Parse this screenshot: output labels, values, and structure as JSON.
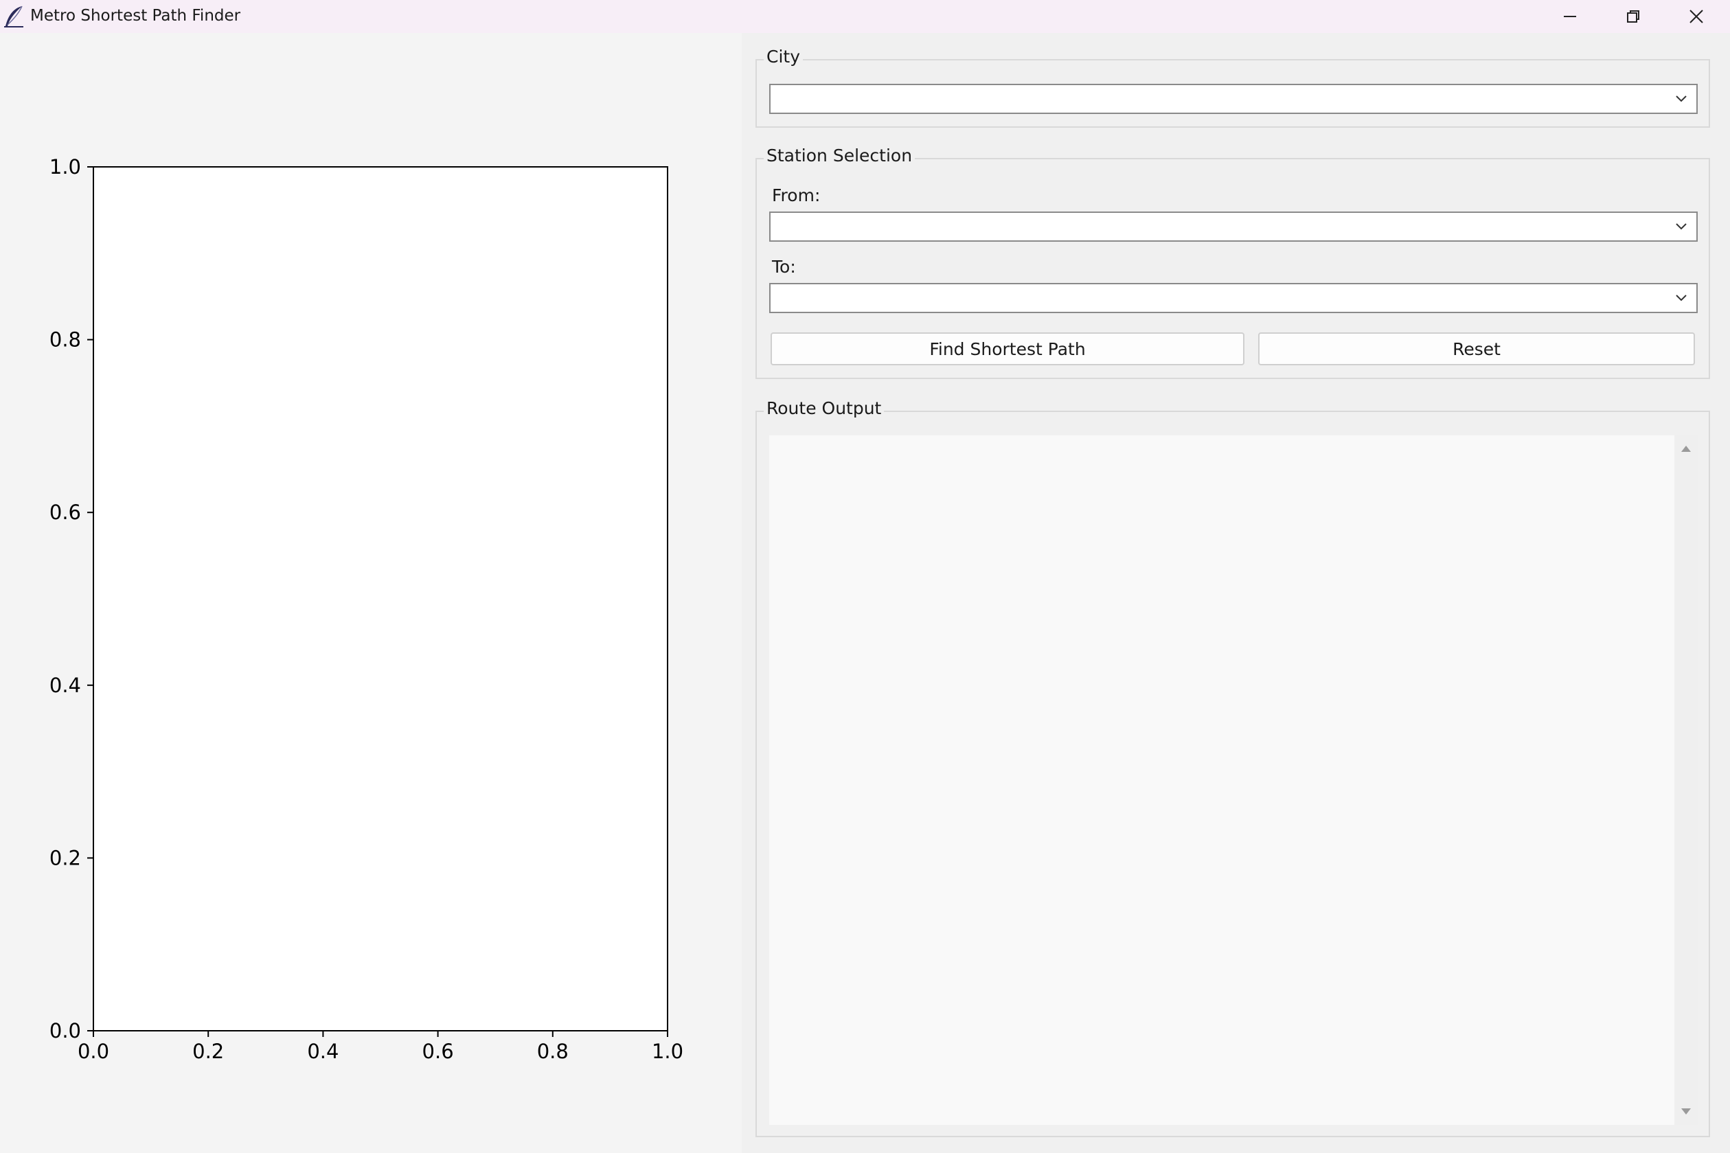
{
  "window": {
    "title": "Metro Shortest Path Finder",
    "icon": "feather-icon",
    "controls": [
      "minimize-icon",
      "restore-icon",
      "close-icon"
    ]
  },
  "city_group": {
    "label": "City",
    "combo_value": ""
  },
  "station_group": {
    "label": "Station Selection",
    "from_label": "From:",
    "from_value": "",
    "to_label": "To:",
    "to_value": "",
    "find_button": "Find Shortest Path",
    "reset_button": "Reset"
  },
  "output_group": {
    "label": "Route Output",
    "text": ""
  },
  "chart_data": {
    "type": "scatter",
    "series": [],
    "xlim": [
      0.0,
      1.0
    ],
    "ylim": [
      0.0,
      1.0
    ],
    "x_ticks": [
      "0.0",
      "0.2",
      "0.4",
      "0.6",
      "0.8",
      "1.0"
    ],
    "y_ticks": [
      "0.0",
      "0.2",
      "0.4",
      "0.6",
      "0.8",
      "1.0"
    ],
    "grid": false
  }
}
